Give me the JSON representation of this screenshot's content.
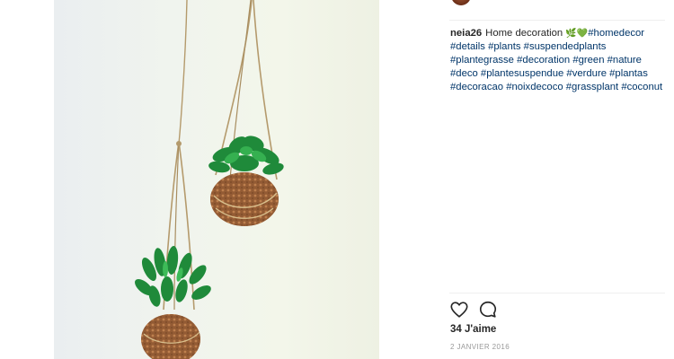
{
  "post": {
    "username": "neia26",
    "caption_text": "Home decoration",
    "emojis": [
      "🌿",
      "💚"
    ],
    "hashtags": [
      "#homedecor",
      "#details",
      "#plants",
      "#suspendedplants",
      "#plantegrasse",
      "#decoration",
      "#green",
      "#nature",
      "#deco",
      "#plantesuspendue",
      "#verdure",
      "#plantas",
      "#decoracao",
      "#noixdecoco",
      "#grassplant",
      "#coconut"
    ],
    "likes_label": "34 J'aime",
    "date": "2 JANVIER 2016"
  },
  "icons": {
    "like": "heart-icon",
    "comment": "comment-icon"
  },
  "colors": {
    "hashtag": "#003569",
    "text": "#262626",
    "muted": "#999999"
  }
}
